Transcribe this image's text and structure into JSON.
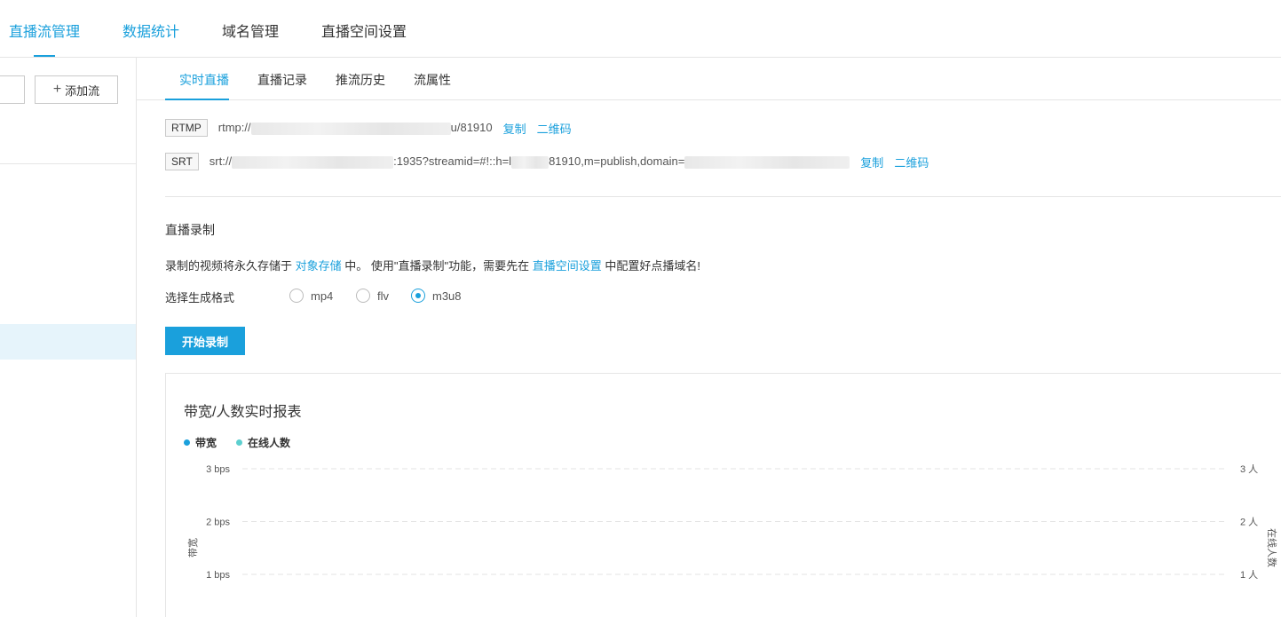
{
  "topnav": {
    "tabs": [
      {
        "label": "直播流管理",
        "active": true
      },
      {
        "label": "数据统计",
        "active": false
      },
      {
        "label": "域名管理",
        "active": false
      },
      {
        "label": "直播空间设置",
        "active": false
      }
    ]
  },
  "leftpanel": {
    "add_button_label": "添加流"
  },
  "subtabs": [
    {
      "label": "实时直播",
      "active": true
    },
    {
      "label": "直播记录",
      "active": false
    },
    {
      "label": "推流历史",
      "active": false
    },
    {
      "label": "流属性",
      "active": false
    }
  ],
  "push": {
    "rtmp": {
      "tag": "RTMP",
      "prefix": "rtmp://",
      "suffix": "u/81910",
      "copy_label": "复制",
      "qr_label": "二维码"
    },
    "srt": {
      "tag": "SRT",
      "prefix": "srt://",
      "middle1": ":1935?streamid=#!::h=l",
      "middle2": "81910,m=publish,domain=",
      "copy_label": "复制",
      "qr_label": "二维码"
    }
  },
  "recording": {
    "title": "直播录制",
    "desc_part1": "录制的视频将永久存储于 ",
    "desc_link1": "对象存储",
    "desc_part2": " 中。 使用\"直播录制\"功能，需要先在 ",
    "desc_link2": "直播空间设置",
    "desc_part3": " 中配置好点播域名!",
    "format_label": "选择生成格式",
    "formats": [
      {
        "label": "mp4",
        "checked": false
      },
      {
        "label": "flv",
        "checked": false
      },
      {
        "label": "m3u8",
        "checked": true
      }
    ],
    "start_button": "开始录制"
  },
  "chart_data": {
    "type": "line",
    "title": "带宽/人数实时报表",
    "series": [
      {
        "name": "带宽",
        "color": "#1aa0dc",
        "values": []
      },
      {
        "name": "在线人数",
        "color": "#5ccfcf",
        "values": []
      }
    ],
    "ylabel_left": "带宽",
    "ylabel_right": "在线人数",
    "left_ticks": [
      "3 bps",
      "2 bps",
      "1 bps"
    ],
    "right_ticks": [
      "3 人",
      "2 人",
      "1 人"
    ],
    "ylim": [
      0,
      3
    ],
    "grid": true,
    "legend": "top-left"
  }
}
